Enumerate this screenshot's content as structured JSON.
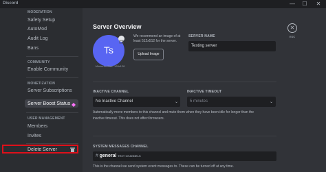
{
  "app": {
    "title": "Discord"
  },
  "window_controls": {
    "minimize": "—",
    "maximize": "☐",
    "close": "✕"
  },
  "sidebar": {
    "moderation_header": "MODERATION",
    "moderation_items": [
      "Safety Setup",
      "AutoMod",
      "Audit Log",
      "Bans"
    ],
    "community_header": "COMMUNITY",
    "community_items": [
      "Enable Community"
    ],
    "monetization_header": "MONETIZATION",
    "monetization_items": [
      "Server Subscriptions",
      "Server Boost Status"
    ],
    "user_mgmt_header": "USER MANAGEMENT",
    "user_mgmt_items": [
      "Members",
      "Invites"
    ],
    "delete_server": "Delete Server",
    "selected_item": "Server Boost Status"
  },
  "overview": {
    "title": "Server Overview",
    "avatar_initials": "Ts",
    "min_size_text": "Minimum Size: 128x128",
    "recommend_text": "We recommend an image of at least 512x512 for the server.",
    "upload_button": "Upload Image",
    "server_name_label": "SERVER NAME",
    "server_name_value": "Testing server"
  },
  "inactive": {
    "channel_label": "INACTIVE CHANNEL",
    "channel_value": "No Inactive Channel",
    "timeout_label": "INACTIVE TIMEOUT",
    "timeout_value": "5 minutes",
    "help_line1": "Automatically move members to this channel and mute them when they have been idle for longer than the",
    "help_line2": "inactive timeout. This does not affect browsers."
  },
  "system": {
    "label": "SYSTEM MESSAGES CHANNEL",
    "channel_value": "general",
    "channel_category": "TEXT CHANNELS",
    "help": "This is the channel we send system event messages to. These can be turned off at any time."
  },
  "close": {
    "esc_label": "ESC"
  }
}
